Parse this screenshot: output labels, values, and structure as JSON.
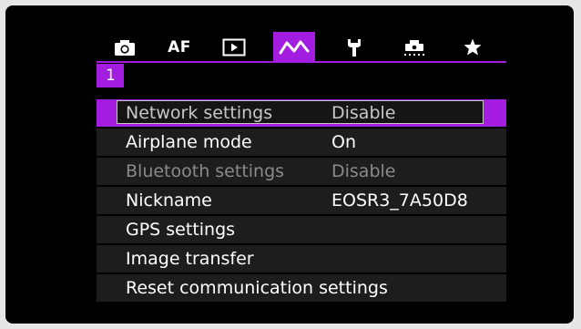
{
  "tabs": [
    {
      "name": "tab-shooting",
      "icon": "camera-icon",
      "label": ""
    },
    {
      "name": "tab-af",
      "icon": "",
      "label": "AF"
    },
    {
      "name": "tab-playback",
      "icon": "play-icon",
      "label": ""
    },
    {
      "name": "tab-wireless",
      "icon": "wireless-icon",
      "label": "",
      "active": true
    },
    {
      "name": "tab-setup",
      "icon": "wrench-icon",
      "label": ""
    },
    {
      "name": "tab-custom",
      "icon": "custom-functions-icon",
      "label": ""
    },
    {
      "name": "tab-my-menu",
      "icon": "star-icon",
      "label": ""
    }
  ],
  "page": {
    "number": "1"
  },
  "menu": {
    "items": [
      {
        "label": "Network settings",
        "value": "Disable",
        "state": "selected"
      },
      {
        "label": "Airplane mode",
        "value": "On",
        "state": "normal"
      },
      {
        "label": "Bluetooth settings",
        "value": "Disable",
        "state": "disabled"
      },
      {
        "label": "Nickname",
        "value": "EOSR3_7A50D8",
        "state": "normal"
      },
      {
        "label": "GPS settings",
        "value": "",
        "state": "normal"
      },
      {
        "label": "Image transfer",
        "value": "",
        "state": "normal"
      },
      {
        "label": "Reset communication settings",
        "value": "",
        "state": "normal"
      }
    ]
  },
  "colors": {
    "accent": "#a31de0",
    "row_bg": "#1d1d1d",
    "text": "#ffffff",
    "disabled_text": "#8a8a8a"
  }
}
